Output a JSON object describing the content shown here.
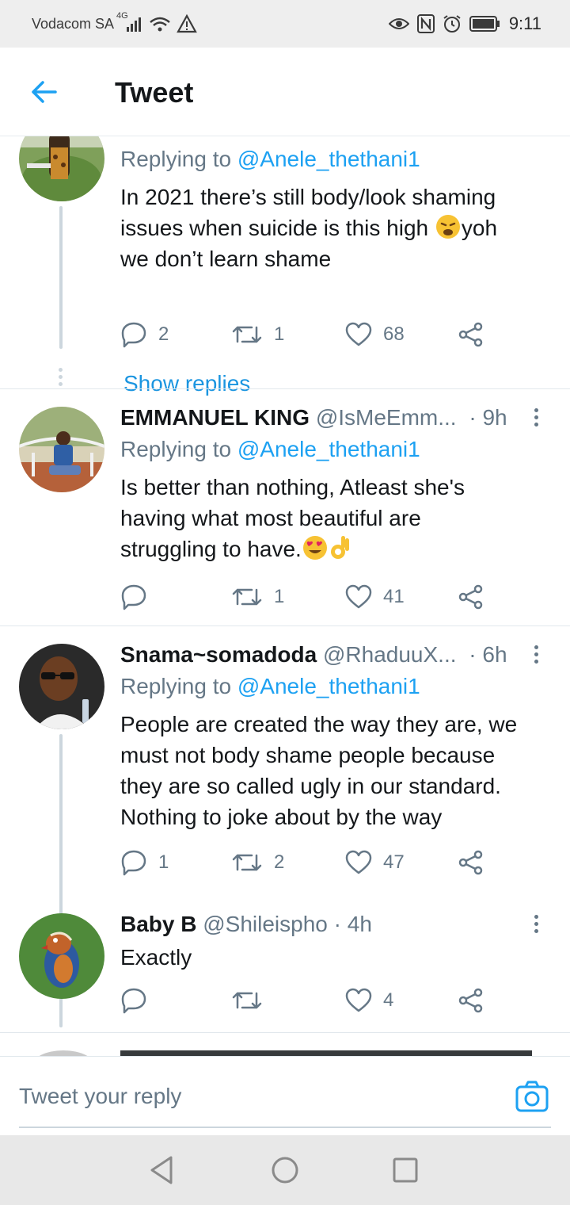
{
  "status_bar": {
    "carrier": "Vodacom SA",
    "network": "4G",
    "time": "9:11"
  },
  "header": {
    "title": "Tweet",
    "back_icon": "arrow-left-icon"
  },
  "tweets": [
    {
      "name": "",
      "handle": "",
      "time": "",
      "replying_label": "Replying to",
      "replying_to": "@Anele_thethani1",
      "text": "In 2021 there’s still body/look shaming issues when suicide is this high 😩yoh we don’t learn shame",
      "text_line1": "In 2021 there’s still body/look shaming",
      "text_line2a": "issues when suicide is this high ",
      "text_line2b": "yoh",
      "text_line3": "we don’t learn shame",
      "replies": "2",
      "retweets": "1",
      "likes": "68",
      "show_replies": "Show replies"
    },
    {
      "name": "EMMANUEL KING",
      "handle": "@IsMeEmm...",
      "time": "· 9h",
      "replying_label": "Replying to",
      "replying_to": "@Anele_thethani1",
      "text_line1": "Is better than nothing, Atleast she's",
      "text_line2": "having what most beautiful are",
      "text_line3": "struggling to have.",
      "replies": "",
      "retweets": "1",
      "likes": "41"
    },
    {
      "name": "Snama~somadoda",
      "handle": "@RhaduuX...",
      "time": "· 6h",
      "replying_label": "Replying to",
      "replying_to": "@Anele_thethani1",
      "text_line1": "People are created the way they are, we",
      "text_line2": "must not body shame people because",
      "text_line3": "they are so called ugly in our standard.",
      "text_line4": "Nothing to joke about by the way",
      "replies": "1",
      "retweets": "2",
      "likes": "47"
    },
    {
      "name": "Baby B",
      "handle": "@Shileispho",
      "time": "· 4h",
      "text": "Exactly",
      "replies": "",
      "retweets": "",
      "likes": "4"
    }
  ],
  "reply_bar": {
    "placeholder": "Tweet your reply",
    "camera_icon": "camera-icon"
  },
  "nav_bar": {
    "back": "back-triangle-icon",
    "home": "home-circle-icon",
    "recents": "recents-square-icon"
  },
  "colors": {
    "accent": "#1da1f2",
    "text": "#14171a",
    "muted": "#657786",
    "divider": "#e1e8ed"
  }
}
